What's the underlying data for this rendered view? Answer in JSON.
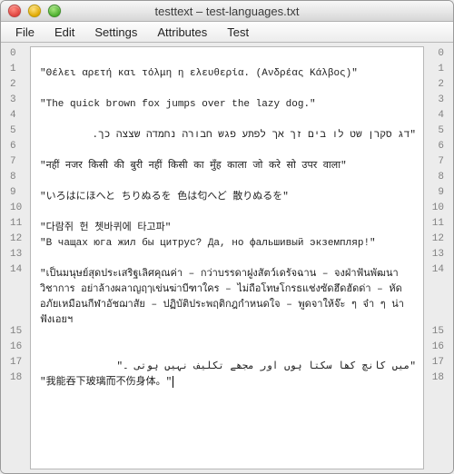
{
  "window": {
    "title": "testtext – test-languages.txt"
  },
  "menu": {
    "items": [
      "File",
      "Edit",
      "Settings",
      "Attributes",
      "Test"
    ]
  },
  "icons": {
    "close": "close-icon",
    "minimize": "minimize-icon",
    "zoom": "zoom-icon"
  },
  "lines": [
    {
      "n": 0,
      "text": ""
    },
    {
      "n": 1,
      "text": "\"Θέλει αρετή και τόλμη η ελευθερία. (Ανδρέας Κάλβος)\""
    },
    {
      "n": 2,
      "text": ""
    },
    {
      "n": 3,
      "text": "\"The quick brown fox jumps over the lazy dog.\""
    },
    {
      "n": 4,
      "text": ""
    },
    {
      "n": 5,
      "text": "\"דג סקרן שט לו בים זך אך לפתע פגש חבורה נחמדה שצצה כך.",
      "rtl": true
    },
    {
      "n": 6,
      "text": ""
    },
    {
      "n": 7,
      "text": "\"नहीं नजर किसी की बुरी नहीं किसी का मुँह काला जो करे सो उपर वाला\""
    },
    {
      "n": 8,
      "text": ""
    },
    {
      "n": 9,
      "text": "\"いろはにほへと ちりぬるを 色は匂へど 散りぬるを\""
    },
    {
      "n": 10,
      "text": ""
    },
    {
      "n": 11,
      "text": "\"다람쥐 헌 쳇바퀴에 타고파\""
    },
    {
      "n": 12,
      "text": "\"В чащах юга жил бы цитрус? Да, но фальшивый экземпляр!\""
    },
    {
      "n": 13,
      "text": ""
    },
    {
      "n": 14,
      "text": "\"เป็นมนุษย์สุดประเสริฐเลิศคุณค่า – กว่าบรรดาฝูงสัตว์เดรัจฉาน – จงฝ่าฟันพัฒนาวิชาการ อย่าล้างผลาญฤๅเข่นฆ่าบีฑาใคร – ไม่ถือโทษโกรธแช่งซัดฮึดฮัดด่า – หัดอภัยเหมือนกีฬาอัชฌาสัย – ปฏิบัติประพฤติกฎกำหนดใจ – พูดจาให้จ๊ะ ๆ จ๋า ๆ น่าฟังเอยฯ",
      "wrap": true
    },
    {
      "n": 15,
      "text": ""
    },
    {
      "n": 16,
      "text": ""
    },
    {
      "n": 17,
      "text": "\"میں کانچ کھا سکتا ہوں اور مجھے تکلیف نہیں ہوتی ۔\"",
      "rtl": true
    },
    {
      "n": 18,
      "text": "\"我能吞下玻璃而不伤身体。\"",
      "cursor": true
    }
  ]
}
